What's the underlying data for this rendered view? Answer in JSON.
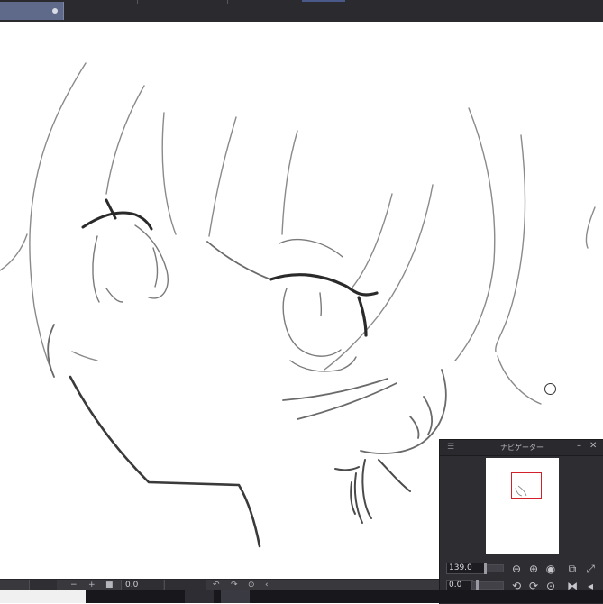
{
  "window": {
    "doc_tab_label": "",
    "accent": "#5f6a8a",
    "background": "#2b2b2f"
  },
  "navigator": {
    "title": "ナビゲーター",
    "menu_icon": "menu-icon",
    "minimize_glyph": "–",
    "close_glyph": "✕",
    "zoom_value": "139.0",
    "rotation_value": "0.0",
    "frame_color": "#d2202a",
    "zoom_out_icon": "⊖",
    "zoom_in_icon": "⊕",
    "actual_size_icon": "◉",
    "fit_icon": "⧉",
    "fit_screen_icon": "⤢",
    "rotate_left_icon": "⟲",
    "rotate_right_icon": "⟳",
    "reset_rotation_icon": "⊙",
    "flip_icon": "⧓",
    "flip_vertical_icon": "◂"
  },
  "status_bar": {
    "minus_label": "−",
    "plus_label": "+",
    "stop_label": "■",
    "value": "0.0",
    "undo_icon": "↶",
    "redo_icon": "↷",
    "reset_icon": "⊙",
    "prev_icon": "‹"
  },
  "canvas": {
    "background": "#ffffff",
    "stroke_color": "#555555"
  }
}
